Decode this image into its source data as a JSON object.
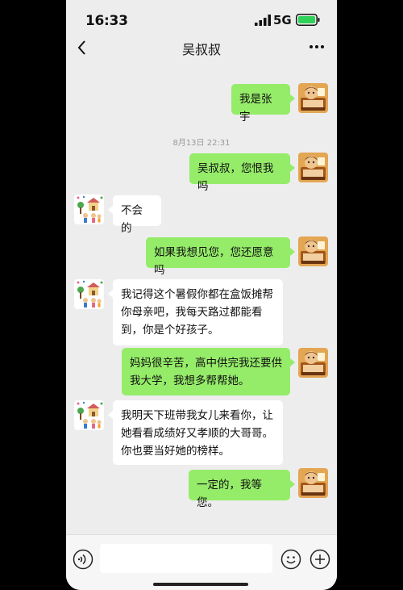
{
  "status": {
    "time": "16:33",
    "network": "5G"
  },
  "chat": {
    "title": "吴叔叔",
    "timestamp": "8月13日 22:31"
  },
  "messages": [
    {
      "from": "self",
      "text": "我是张宇"
    },
    {
      "from": "self",
      "text": "吴叔叔，您恨我吗"
    },
    {
      "from": "other",
      "text": "不会的"
    },
    {
      "from": "self",
      "text": "如果我想见您，您还愿意吗"
    },
    {
      "from": "other",
      "lines": [
        "我记得这个暑假你都在盒饭摊帮",
        "你母亲吧，我每天路过都能看",
        "到，你是个好孩子。"
      ]
    },
    {
      "from": "self",
      "lines": [
        "妈妈很辛苦，高中供完我还要供",
        "我大学，我想多帮帮她。"
      ]
    },
    {
      "from": "other",
      "lines": [
        "我明天下班带我女儿来看你，让",
        "她看看成绩好又孝顺的大哥哥。",
        "你也要当好她的榜样。"
      ]
    },
    {
      "from": "self",
      "text": "一定的，我等您。"
    }
  ],
  "input": {
    "value": ""
  },
  "icons": {
    "back": "chevron-left-icon",
    "more": "more-dots-icon",
    "voice": "voice-icon",
    "emoji": "emoji-icon",
    "plus": "plus-icon"
  },
  "colors": {
    "outgoing_bubble": "#95ec69",
    "incoming_bubble": "#ffffff",
    "background": "#ededed"
  }
}
